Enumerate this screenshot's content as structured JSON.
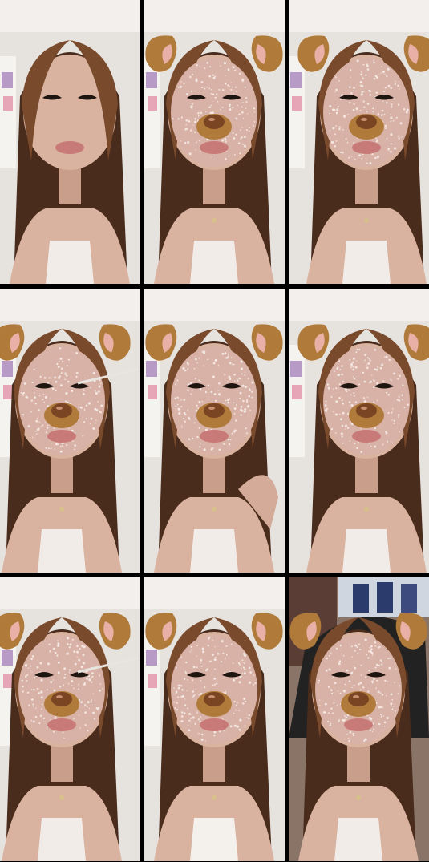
{
  "layout": {
    "columns": 3,
    "rows": 3,
    "background": "#000000"
  },
  "frames": [
    {
      "id": "frame-1",
      "filter": "none",
      "face_shift": 0,
      "scene": "bedroom"
    },
    {
      "id": "frame-2",
      "filter": "dog-ears-glitter",
      "face_shift": 0,
      "scene": "bedroom"
    },
    {
      "id": "frame-3",
      "filter": "dog-ears-glitter",
      "face_shift": 10,
      "scene": "bedroom"
    },
    {
      "id": "frame-4",
      "filter": "dog-ears-glitter",
      "face_shift": -10,
      "scene": "bedroom",
      "holding_brush": true
    },
    {
      "id": "frame-5",
      "filter": "dog-ears-glitter",
      "face_shift": 0,
      "scene": "bedroom",
      "hand_at_chin": true
    },
    {
      "id": "frame-6",
      "filter": "dog-ears-glitter",
      "face_shift": 10,
      "scene": "bedroom"
    },
    {
      "id": "frame-7",
      "filter": "dog-ears-glitter",
      "face_shift": -10,
      "scene": "bedroom",
      "holding_brush": true
    },
    {
      "id": "frame-8",
      "filter": "dog-ears-glitter",
      "face_shift": 0,
      "scene": "bedroom",
      "white_top": true
    },
    {
      "id": "frame-9",
      "filter": "dog-ears-glitter",
      "face_shift": 0,
      "scene": "poster-wall"
    }
  ],
  "colors": {
    "hair": "#4a2c1c",
    "hair_light": "#7a4a2c",
    "skin": "#d9b3a0",
    "ear_outer": "#b07a3a",
    "ear_inner": "#e8b0a6",
    "glitter": "#f3e6e0",
    "nose": "#7a4522",
    "wall": "#e6e2de",
    "shadow": "#3a2a22"
  }
}
